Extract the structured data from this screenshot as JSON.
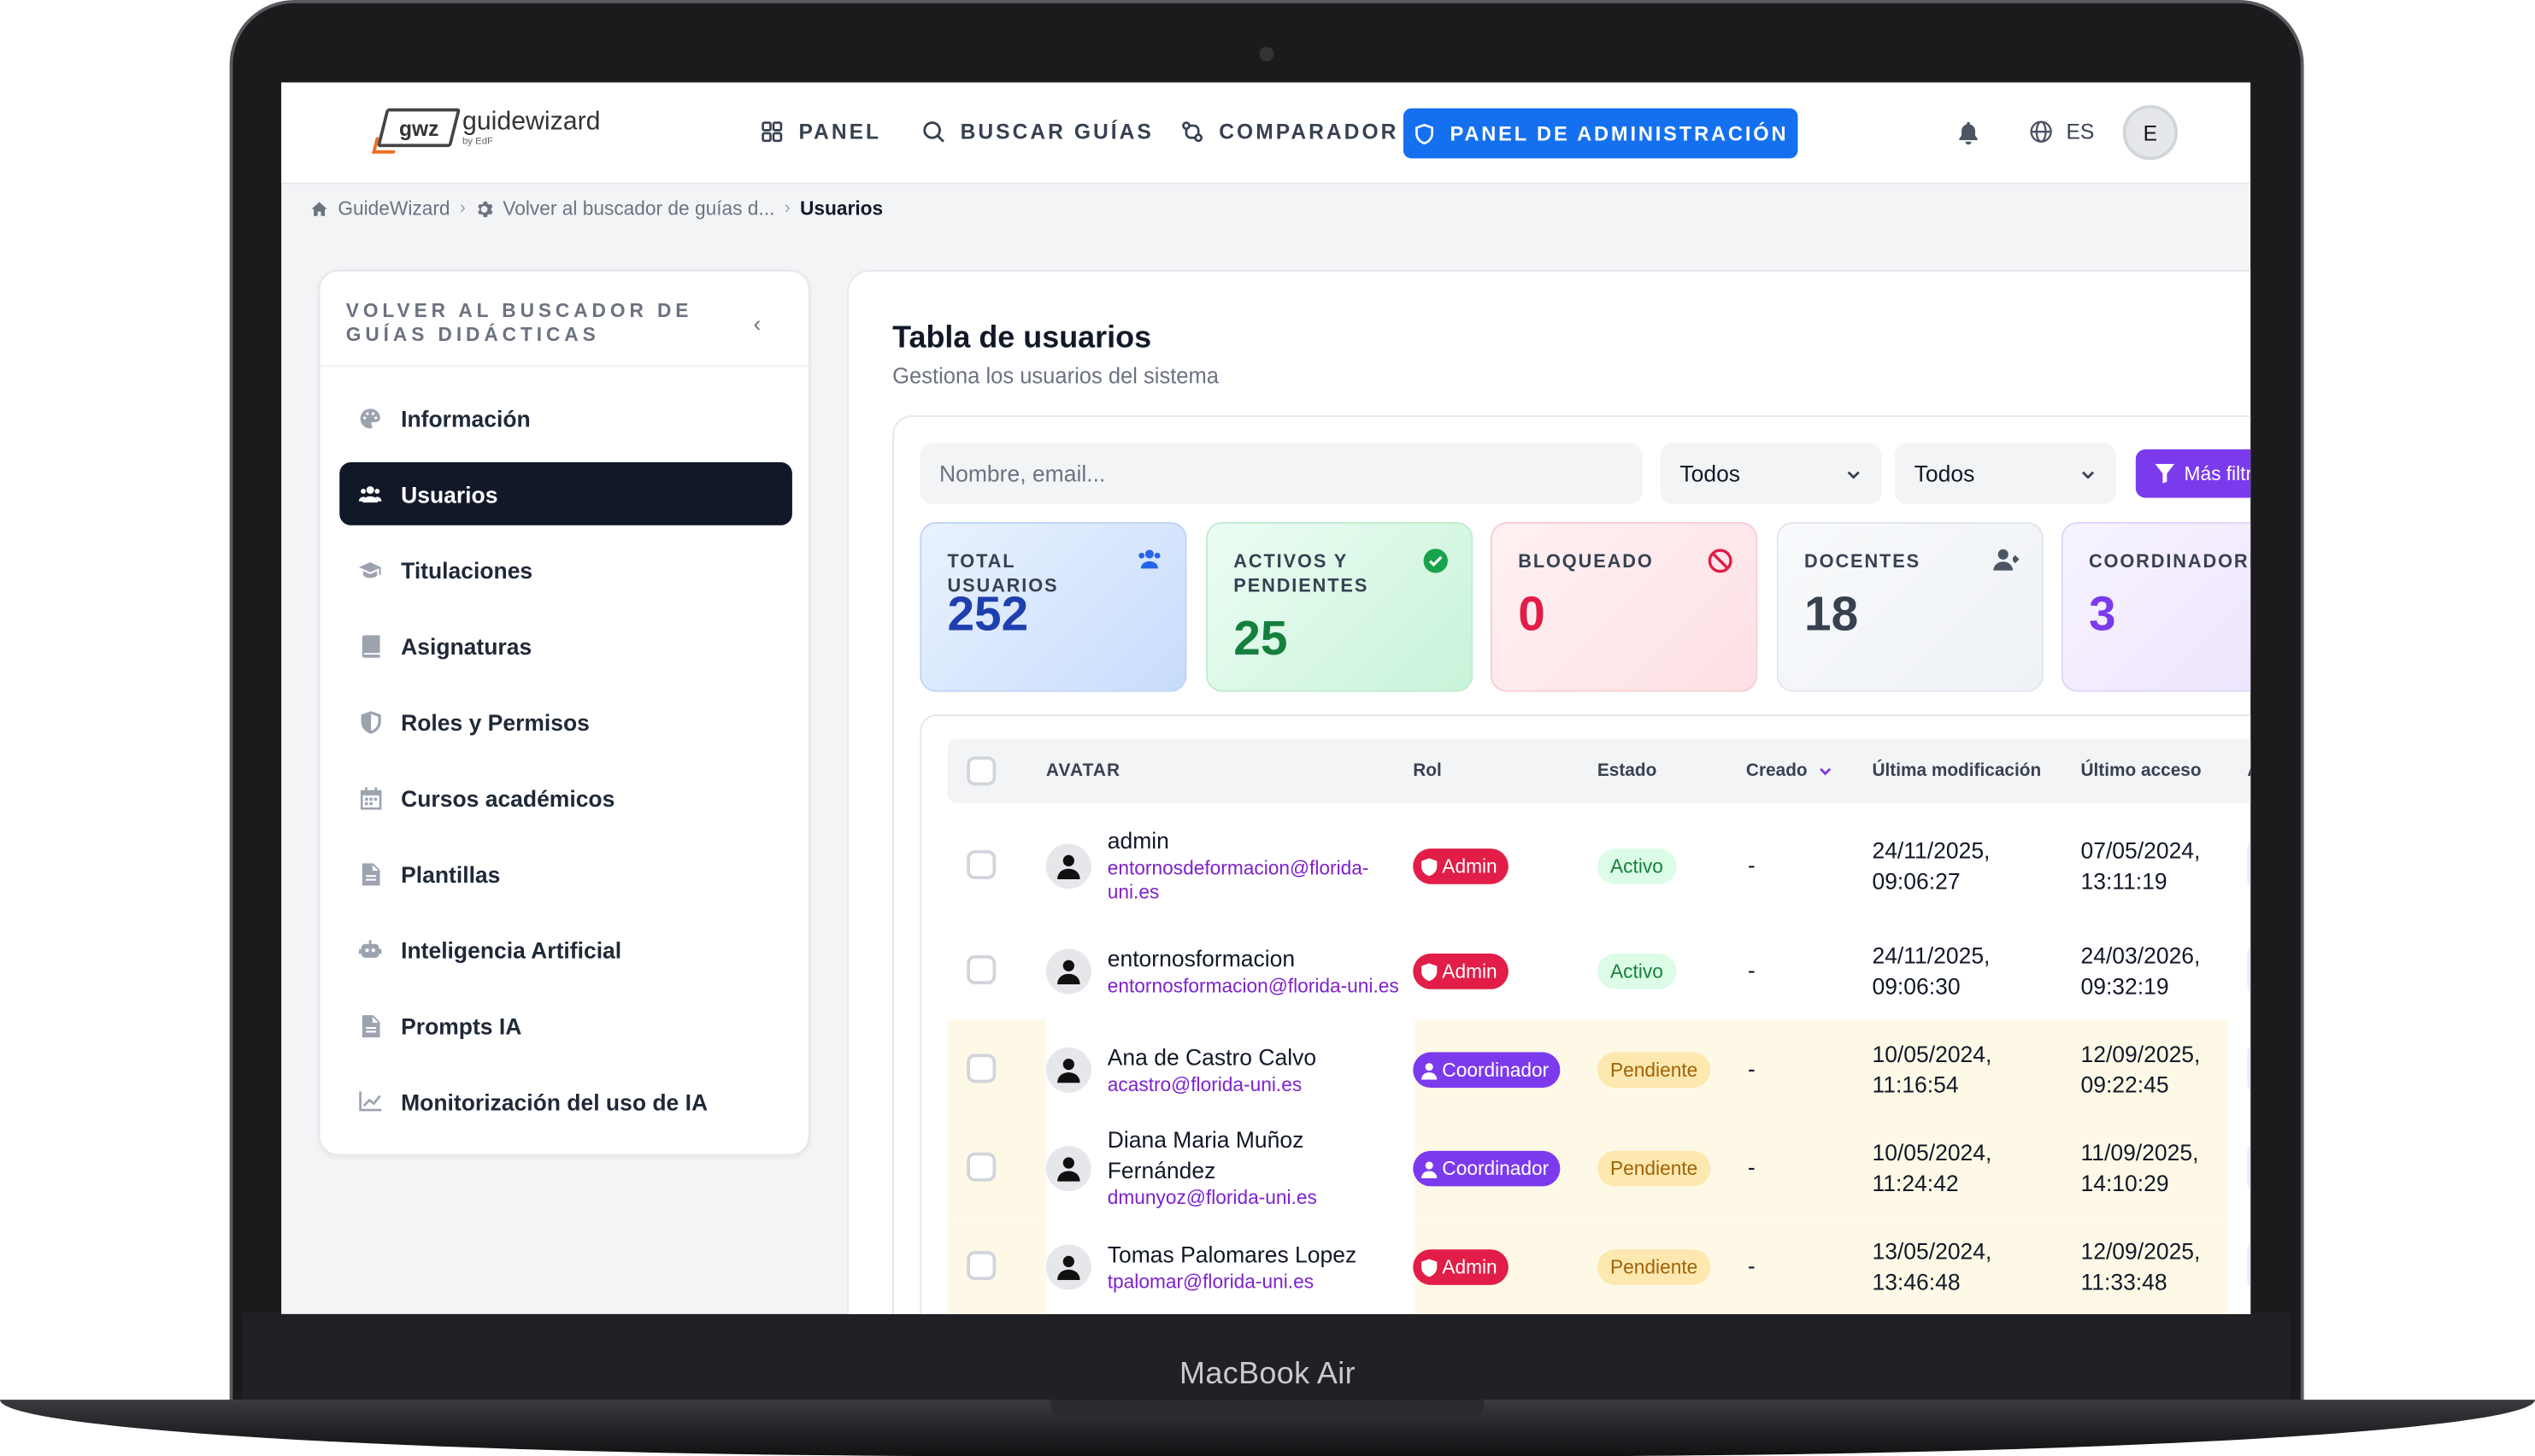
{
  "device": {
    "brand": "MacBook Air"
  },
  "logo": {
    "mark": "gwz",
    "name": "guidewizard",
    "sub": "by EdF"
  },
  "nav": {
    "panel": "PANEL",
    "buscar": "BUSCAR GUÍAS",
    "comparador": "COMPARADOR",
    "admin": "PANEL DE ADMINISTRACIÓN",
    "lang": "ES",
    "avatar_initial": "E"
  },
  "breadcrumb": {
    "home": "GuideWizard",
    "back": "Volver al buscador de guías d...",
    "current": "Usuarios"
  },
  "sidebar": {
    "header": "VOLVER AL BUSCADOR DE GUÍAS DIDÁCTICAS",
    "items": [
      {
        "label": "Información",
        "icon": "palette-icon"
      },
      {
        "label": "Usuarios",
        "icon": "users-icon"
      },
      {
        "label": "Titulaciones",
        "icon": "graduation-cap-icon"
      },
      {
        "label": "Asignaturas",
        "icon": "book-icon"
      },
      {
        "label": "Roles y Permisos",
        "icon": "shield-icon"
      },
      {
        "label": "Cursos académicos",
        "icon": "calendar-icon"
      },
      {
        "label": "Plantillas",
        "icon": "file-icon"
      },
      {
        "label": "Inteligencia Artificial",
        "icon": "robot-icon"
      },
      {
        "label": "Prompts IA",
        "icon": "file-icon"
      },
      {
        "label": "Monitorización del uso de IA",
        "icon": "chart-line-icon"
      }
    ]
  },
  "main": {
    "title": "Tabla de usuarios",
    "subtitle": "Gestiona los usuarios del sistema",
    "search_placeholder": "Nombre, email...",
    "filter1": "Todos",
    "filter2": "Todos",
    "more_filters": "Más filtr"
  },
  "stats": [
    {
      "label": "TOTAL USUARIOS",
      "value": "252",
      "color": "#1e40af"
    },
    {
      "label": "ACTIVOS Y PENDIENTES",
      "value": "25",
      "color": "#15803d"
    },
    {
      "label": "BLOQUEADO",
      "value": "0",
      "color": "#e11d48"
    },
    {
      "label": "DOCENTES",
      "value": "18",
      "color": "#374151"
    },
    {
      "label": "COORDINADORES",
      "value": "3",
      "color": "#7c3aed"
    }
  ],
  "table": {
    "headers": {
      "avatar": "AVATAR",
      "rol": "Rol",
      "estado": "Estado",
      "creado": "Creado",
      "modif": "Última modificación",
      "acceso": "Último acceso",
      "extra": "A"
    },
    "rows": [
      {
        "name": "admin",
        "email": "entornosdeformacion@florida-uni.es",
        "role": "Admin",
        "estado": "Activo",
        "creado": "-",
        "modif": [
          "24/11/2025,",
          "09:06:27"
        ],
        "acceso": [
          "07/05/2024,",
          "13:11:19"
        ]
      },
      {
        "name": "entornosformacion",
        "email": "entornosformacion@florida-uni.es",
        "role": "Admin",
        "estado": "Activo",
        "creado": "-",
        "modif": [
          "24/11/2025,",
          "09:06:30"
        ],
        "acceso": [
          "24/03/2026,",
          "09:32:19"
        ]
      },
      {
        "name": "Ana de Castro Calvo",
        "email": "acastro@florida-uni.es",
        "role": "Coordinador",
        "estado": "Pendiente",
        "creado": "-",
        "modif": [
          "10/05/2024,",
          "11:16:54"
        ],
        "acceso": [
          "12/09/2025,",
          "09:22:45"
        ]
      },
      {
        "name": "Diana Maria Muñoz Fernández",
        "email": "dmunyoz@florida-uni.es",
        "role": "Coordinador",
        "estado": "Pendiente",
        "creado": "-",
        "modif": [
          "10/05/2024,",
          "11:24:42"
        ],
        "acceso": [
          "11/09/2025,",
          "14:10:29"
        ]
      },
      {
        "name": "Tomas Palomares Lopez",
        "email": "tpalomar@florida-uni.es",
        "role": "Admin",
        "estado": "Pendiente",
        "creado": "-",
        "modif": [
          "13/05/2024,",
          "13:46:48"
        ],
        "acceso": [
          "12/09/2025,",
          "11:33:48"
        ]
      }
    ]
  },
  "colors": {
    "primary": "#1570ef",
    "sidebar_active": "#111827",
    "purple": "#7c3aed",
    "admin_red": "#e11d48"
  }
}
